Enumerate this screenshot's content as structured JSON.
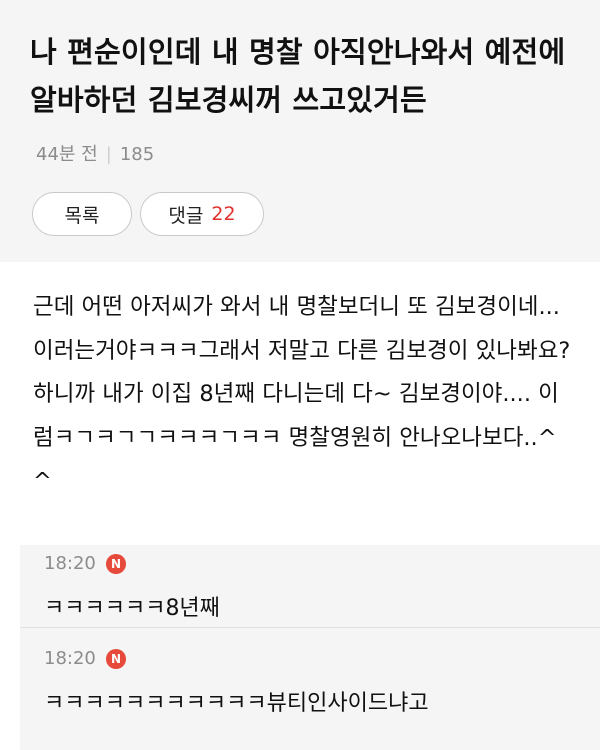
{
  "post": {
    "title": "나 편순이인데 내 명찰 아직안나와서 예전에 알바하던 김보경씨꺼 쓰고있거든",
    "time": "44분 전",
    "views": "185",
    "body": "근데 어떤 아저씨가 와서 내 명찰보더니 또 김보경이네... 이러는거야ㅋㅋㅋ그래서 저말고 다른 김보경이 있나봐요? 하니까 내가 이집 8년째 다니는데 다~ 김보경이야.... 이럼ㅋㄱㅋㄱㄱㅋㅋㅋㄱㅋㅋ 명찰영원히 안나오나보다..^^"
  },
  "buttons": {
    "list_label": "목록",
    "comments_label": "댓글",
    "comments_count": "22"
  },
  "comments": [
    {
      "time": "18:20",
      "badge": "N",
      "text": "ㅋㅋㅋㅋㅋㅋ8년째"
    },
    {
      "time": "18:20",
      "badge": "N",
      "text": "ㅋㅋㅋㅋㅋㅋㅋㅋㅋㅋㅋ뷰티인사이드냐고"
    }
  ],
  "colors": {
    "accent_red": "#e0312e",
    "badge_red": "#e64a3a",
    "header_bg": "#f5f5f5"
  }
}
